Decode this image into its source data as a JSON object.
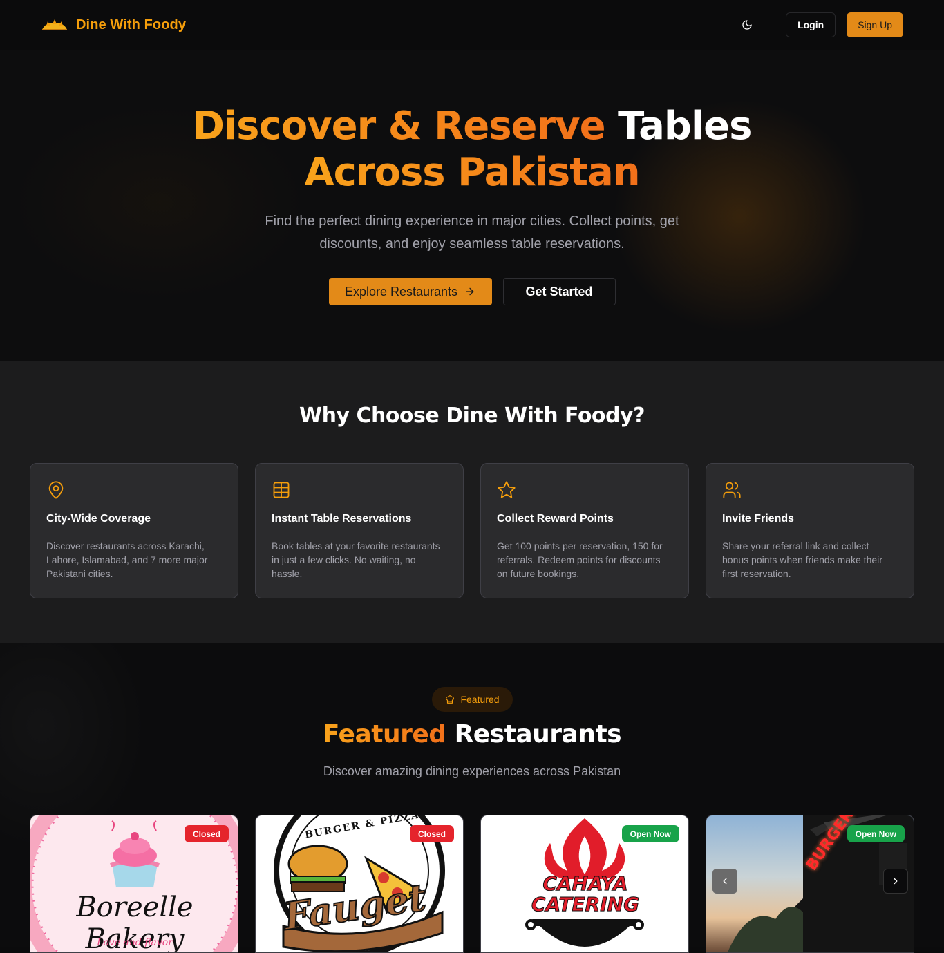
{
  "brand": {
    "name": "Dine With Foody"
  },
  "nav": {
    "login_label": "Login",
    "signup_label": "Sign Up",
    "theme_icon": "moon-icon"
  },
  "hero": {
    "title_part1": "Discover & Reserve",
    "title_part2": "Tables",
    "title_part3": "Across Pakistan",
    "subtitle_line1": "Find the perfect dining experience in major cities. Collect points, get",
    "subtitle_line2": "discounts, and enjoy seamless table reservations.",
    "explore_label": "Explore Restaurants",
    "get_started_label": "Get Started"
  },
  "features": {
    "title": "Why Choose Dine With Foody?",
    "items": [
      {
        "icon": "map-pin-icon",
        "title": "City-Wide Coverage",
        "desc": "Discover restaurants across Karachi, Lahore, Islamabad, and 7 more major Pakistani cities."
      },
      {
        "icon": "table-icon",
        "title": "Instant Table Reservations",
        "desc": "Book tables at your favorite restaurants in just a few clicks. No waiting, no hassle."
      },
      {
        "icon": "star-icon",
        "title": "Collect Reward Points",
        "desc": "Get 100 points per reservation, 150 for referrals. Redeem points for discounts on future bookings."
      },
      {
        "icon": "users-icon",
        "title": "Invite Friends",
        "desc": "Share your referral link and collect bonus points when friends make their first reservation."
      }
    ]
  },
  "featured": {
    "badge_label": "Featured",
    "title_part1": "Featured",
    "title_part2": "Restaurants",
    "subtitle": "Discover amazing dining experiences across Pakistan",
    "restaurants": [
      {
        "logo_text": "Boreelle Bakery",
        "logo_tagline": "Love and flavor",
        "status": "Closed"
      },
      {
        "logo_text": "Fauget",
        "logo_tagline": "BURGER & PIZZA",
        "status": "Closed"
      },
      {
        "logo_text_line1": "CAHAYA",
        "logo_text_line2": "CATERING",
        "status": "Open Now"
      },
      {
        "sign_text": "BURGERIZZA",
        "status": "Open Now"
      }
    ]
  },
  "colors": {
    "accent": "#e38a18",
    "closed": "#e5242c",
    "open": "#18a34a"
  }
}
